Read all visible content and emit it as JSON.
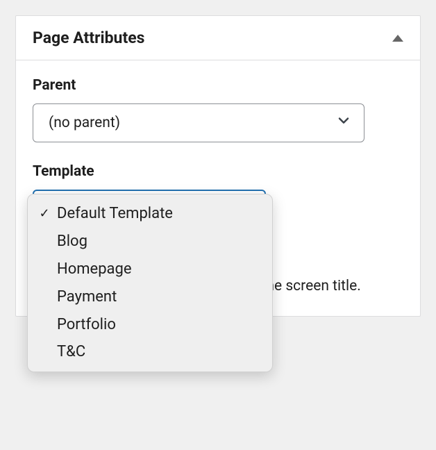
{
  "panel": {
    "title": "Page Attributes",
    "parent_label": "Parent",
    "parent_value": "(no parent)",
    "template_label": "Template",
    "template_options": [
      {
        "label": "Default Template",
        "selected": true
      },
      {
        "label": "Blog",
        "selected": false
      },
      {
        "label": "Homepage",
        "selected": false
      },
      {
        "label": "Payment",
        "selected": false
      },
      {
        "label": "Portfolio",
        "selected": false
      },
      {
        "label": "T&C",
        "selected": false
      }
    ],
    "help_text": "Need help? Use the Help tab above the screen title."
  }
}
